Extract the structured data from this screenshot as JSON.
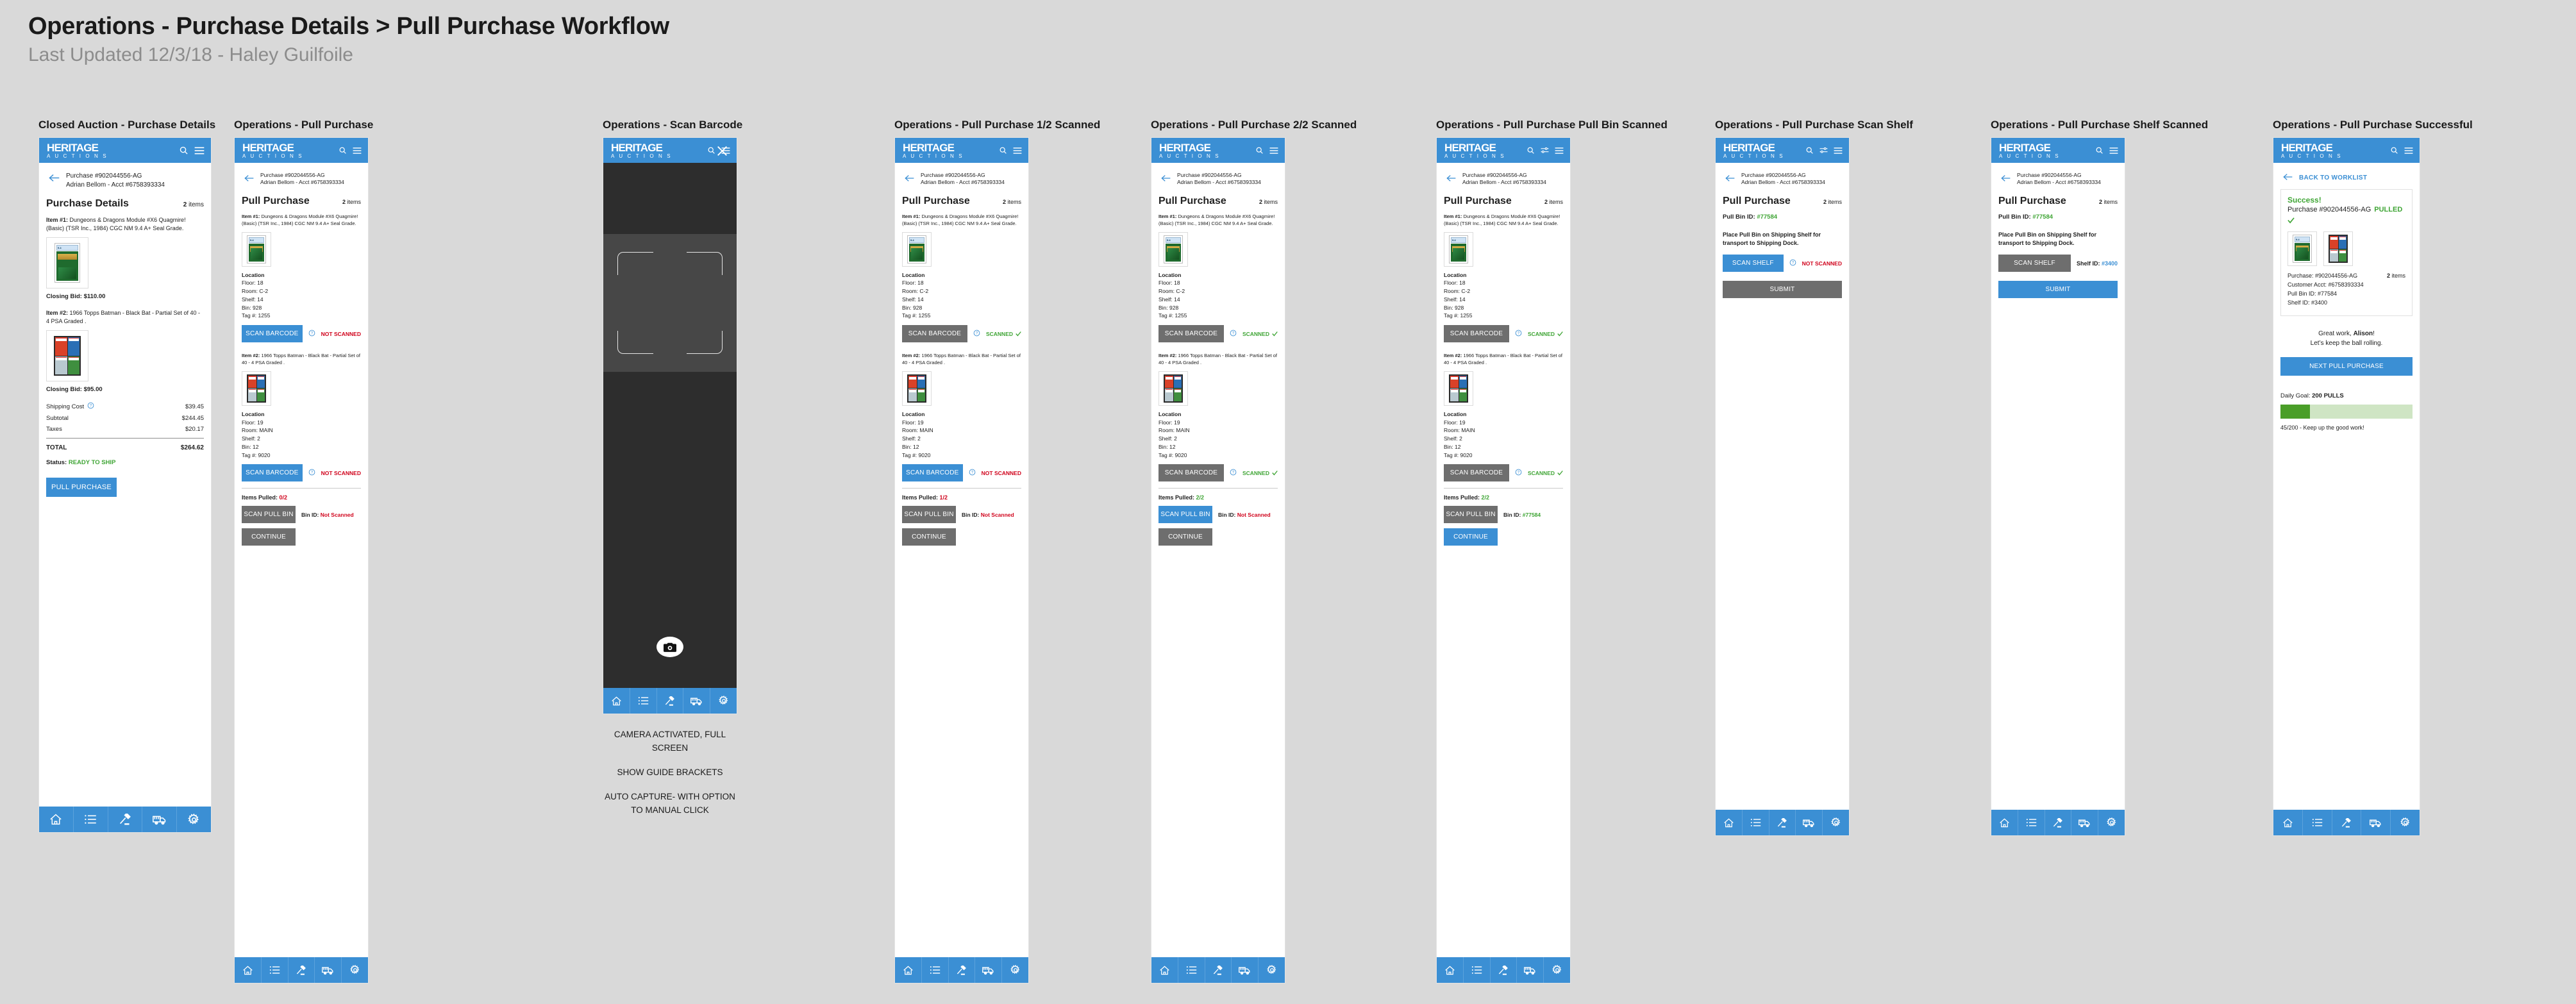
{
  "page": {
    "title": "Operations - Purchase Details > Pull Purchase Workflow",
    "subtitle": "Last Updated 12/3/18 - Haley Guilfoile"
  },
  "brand": {
    "line1": "HERITAGE",
    "line2": "A U C T I O N S",
    "accent": "#3b8fd4"
  },
  "colors": {
    "accent": "#3b8fd4",
    "danger": "#d0021b",
    "success": "#3fa535",
    "disabled": "#6e6e6e"
  },
  "common": {
    "purchase_line1": "Purchase #902044556-AG",
    "purchase_line2": "Adrian Bellom - Acct #6758393334",
    "items_count_num": "2",
    "items_count_word": "items",
    "item1_label": "Item #1:",
    "item1_desc": "Dungeons & Dragons Module #X6 Quagmire! (Basic) (TSR Inc., 1984) CGC NM 9.4 A+ Seal Grade.",
    "item2_label": "Item #2:",
    "item2_desc": "1966 Topps Batman - Black Bat - Partial Set of 40 - 4 PSA Graded .",
    "location_label": "Location",
    "loc1": {
      "floor": "Floor: 18",
      "room": "Room: C-2",
      "shelf": "Shelf: 14",
      "bin": "Bin: 928",
      "tag": "Tag #: 1255"
    },
    "loc2": {
      "floor": "Floor: 19",
      "room": "Room: MAIN",
      "shelf": "Shelf: 2",
      "bin": "Bin: 12",
      "tag": "Tag #: 9020"
    },
    "scan_barcode": "SCAN BARCODE",
    "scan_pull_bin": "SCAN PULL BIN",
    "continue": "CONTINUE",
    "scan_shelf": "SCAN SHELF",
    "submit": "SUBMIT",
    "not_scanned": "NOT SCANNED",
    "scanned": "SCANNED",
    "bin_id_label": "Bin ID:",
    "bin_not_scanned": "Not Scanned",
    "bin_id_value": "#77584",
    "items_pulled_label": "Items Pulled:",
    "pull_purchase_heading": "Pull Purchase"
  },
  "nav": {
    "items": [
      {
        "name": "home-icon",
        "label": "Home"
      },
      {
        "name": "list-icon",
        "label": "Worklist"
      },
      {
        "name": "gavel-icon",
        "label": "Auctions"
      },
      {
        "name": "truck-icon",
        "label": "Shipping"
      },
      {
        "name": "gear-icon",
        "label": "Settings"
      }
    ]
  },
  "panels": [
    {
      "caption": "Closed Auction - Purchase Details",
      "section_title": "Purchase Details",
      "closing_bid_1": "Closing Bid: $110.00",
      "closing_bid_2": "Closing Bid: $95.00",
      "shipping_label": "Shipping Cost",
      "shipping_value": "$39.45",
      "subtotal_label": "Subtotal",
      "subtotal_value": "$244.45",
      "taxes_label": "Taxes",
      "taxes_value": "$20.17",
      "total_label": "TOTAL",
      "total_value": "$264.62",
      "status_label": "Status:",
      "status_value": "READY TO SHIP",
      "cta": "PULL PURCHASE"
    },
    {
      "caption": "Operations - Pull Purchase",
      "scan1_state": "NOT SCANNED",
      "scan2_state": "NOT SCANNED",
      "items_pulled": "0/2",
      "bin_id": "Not Scanned"
    },
    {
      "caption": "Operations - Scan Barcode",
      "note1": "CAMERA ACTIVATED, FULL SCREEN",
      "note2": "SHOW GUIDE BRACKETS",
      "note3": "AUTO CAPTURE- WITH OPTION TO MANUAL CLICK"
    },
    {
      "caption": "Operations - Pull Purchase 1/2 Scanned",
      "scan1_state": "SCANNED",
      "scan2_state": "NOT SCANNED",
      "items_pulled": "1/2",
      "bin_id": "Not Scanned"
    },
    {
      "caption": "Operations - Pull Purchase 2/2 Scanned",
      "scan1_state": "SCANNED",
      "scan2_state": "SCANNED",
      "items_pulled": "2/2",
      "bin_id": "Not Scanned"
    },
    {
      "caption": "Operations - Pull Purchase Pull Bin Scanned",
      "scan1_state": "SCANNED",
      "scan2_state": "SCANNED",
      "items_pulled": "2/2",
      "bin_id": "#77584"
    },
    {
      "caption": "Operations - Pull Purchase Scan Shelf",
      "pull_bin_label": "Pull Bin ID:",
      "pull_bin_value": "#77584",
      "place_note": "Place Pull Bin on Shipping Shelf for transport to Shipping Dock.",
      "shelf_state": "NOT SCANNED"
    },
    {
      "caption": "Operations - Pull Purchase Shelf Scanned",
      "pull_bin_label": "Pull Bin ID:",
      "pull_bin_value": "#77584",
      "place_note": "Place Pull Bin on Shipping Shelf for transport to Shipping Dock.",
      "shelf_id_label": "Shelf ID:",
      "shelf_id_value": "#3400"
    },
    {
      "caption": "Operations - Pull Purchase Successful",
      "back_to_worklist": "BACK TO WORKLIST",
      "success": "Success!",
      "pulled_line": "Purchase #902044556-AG",
      "pulled_word": "PULLED",
      "meta_purchase": "Purchase: #902044556-AG",
      "meta_customer": "Customer Acct: #6758393334",
      "meta_pullbin": "Pull Bin ID: #77584",
      "meta_shelf": "Shelf ID: #3400",
      "greatwork_1": "Great work, ",
      "greatwork_name": "Alison",
      "greatwork_2": "!",
      "greatwork_3": "Let’s keep the ball rolling.",
      "next_cta": "NEXT PULL PURCHASE",
      "goal_label": "Daily Goal:",
      "goal_value": "200 PULLS",
      "goal_progress": "45/200 - Keep up the good work!",
      "goal_percent": 22.5
    }
  ]
}
